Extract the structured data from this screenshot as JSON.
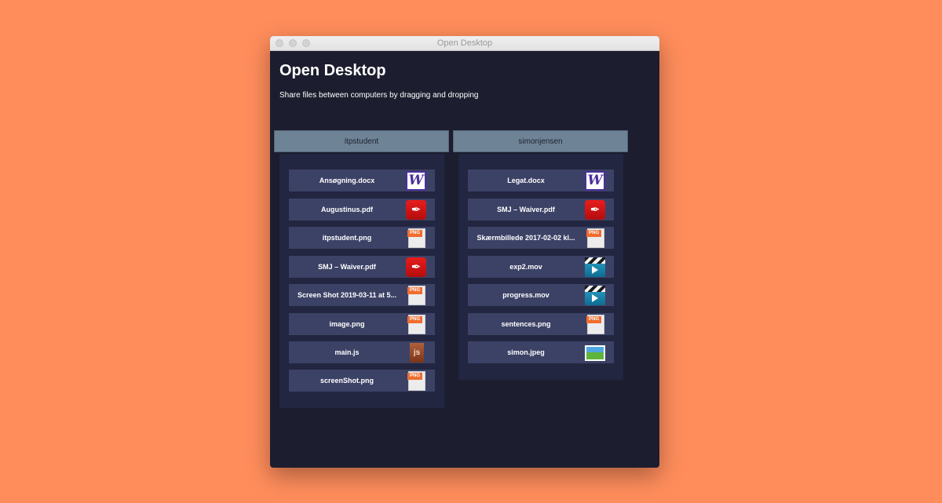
{
  "window": {
    "title": "Open Desktop"
  },
  "main": {
    "heading": "Open Desktop",
    "subtitle": "Share files between computers by dragging and dropping"
  },
  "columns": [
    {
      "user": "itpstudent",
      "files": [
        {
          "name": "Ansøgning.docx",
          "icon": "word-icon"
        },
        {
          "name": "Augustinus.pdf",
          "icon": "pdf-icon"
        },
        {
          "name": "itpstudent.png",
          "icon": "png-icon"
        },
        {
          "name": "SMJ – Waiver.pdf",
          "icon": "pdf-icon"
        },
        {
          "name": "Screen Shot 2019-03-11 at 5...",
          "icon": "png-icon"
        },
        {
          "name": "image.png",
          "icon": "png-icon"
        },
        {
          "name": "main.js",
          "icon": "js-icon"
        },
        {
          "name": "screenShot.png",
          "icon": "png-icon"
        }
      ]
    },
    {
      "user": "simonjensen",
      "files": [
        {
          "name": "Legat.docx",
          "icon": "word-icon"
        },
        {
          "name": "SMJ – Waiver.pdf",
          "icon": "pdf-icon"
        },
        {
          "name": "Skærmbillede 2017-02-02 kl...",
          "icon": "png-icon"
        },
        {
          "name": "exp2.mov",
          "icon": "mov-icon"
        },
        {
          "name": "progress.mov",
          "icon": "mov-icon"
        },
        {
          "name": "sentences.png",
          "icon": "png-icon"
        },
        {
          "name": "simon.jpeg",
          "icon": "jpeg-icon"
        }
      ]
    }
  ],
  "icon_labels": {
    "word": "W",
    "pdf": "✒",
    "png": "PNG",
    "js": "js"
  },
  "colors": {
    "background": "#ff8d5c",
    "window": "#1c1d2e",
    "panel": "#232640",
    "file_row": "#3c4266",
    "user_header": "#6e8396"
  }
}
